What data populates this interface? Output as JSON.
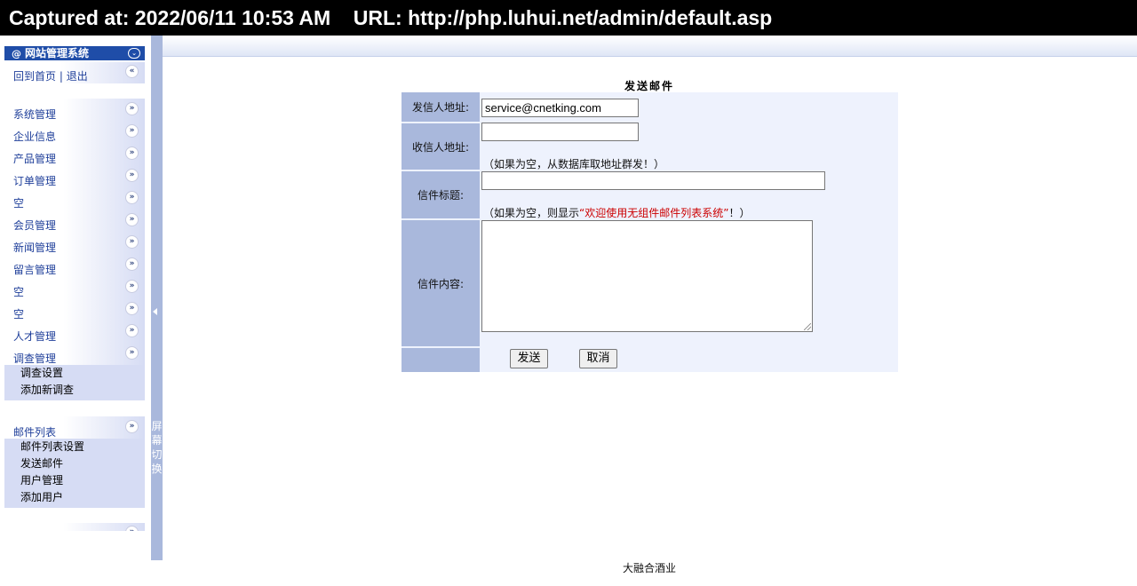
{
  "capture": {
    "text": "Captured at: 2022/06/11 10:53 AM    URL: http://php.luhui.net/admin/default.asp"
  },
  "sidebar": {
    "header": "网站管理系统",
    "links": {
      "home": "回到首页",
      "sep": " | ",
      "logout": "退出"
    },
    "menu": [
      {
        "label": "系统管理"
      },
      {
        "label": "企业信息"
      },
      {
        "label": "产品管理"
      },
      {
        "label": "订单管理"
      },
      {
        "label": "空"
      },
      {
        "label": "会员管理"
      },
      {
        "label": "新闻管理"
      },
      {
        "label": "留言管理"
      },
      {
        "label": "空"
      },
      {
        "label": "空"
      },
      {
        "label": "人才管理"
      },
      {
        "label": "调查管理"
      }
    ],
    "survey_sub": [
      "调查设置",
      "添加新调查"
    ],
    "mail_menu": "邮件列表",
    "mail_sub": [
      "邮件列表设置",
      "发送邮件",
      "用户管理",
      "添加用户"
    ],
    "toggle_text": "屏幕切换"
  },
  "form": {
    "title": "发送邮件",
    "from_label": "发信人地址:",
    "from_value": "service@cnetking.com",
    "to_label": "收信人地址:",
    "to_value": "",
    "to_hint": "（如果为空，从数据库取地址群发！）",
    "subject_label": "信件标题:",
    "subject_value": "",
    "subject_hint_pre": "（如果为空，则显示",
    "subject_hint_red": "“欢迎使用无组件邮件列表系统”",
    "subject_hint_post": "！）",
    "content_label": "信件内容:",
    "send_button": "发送",
    "cancel_button": "取消"
  },
  "footer": "大融合酒业",
  "colors": {
    "sidebar_header": "#1f4da8",
    "label_bg": "#a9b8dc",
    "form_bg": "#eef2fd",
    "hint_red": "#cc0000",
    "link_blue": "#1f3f9a"
  }
}
